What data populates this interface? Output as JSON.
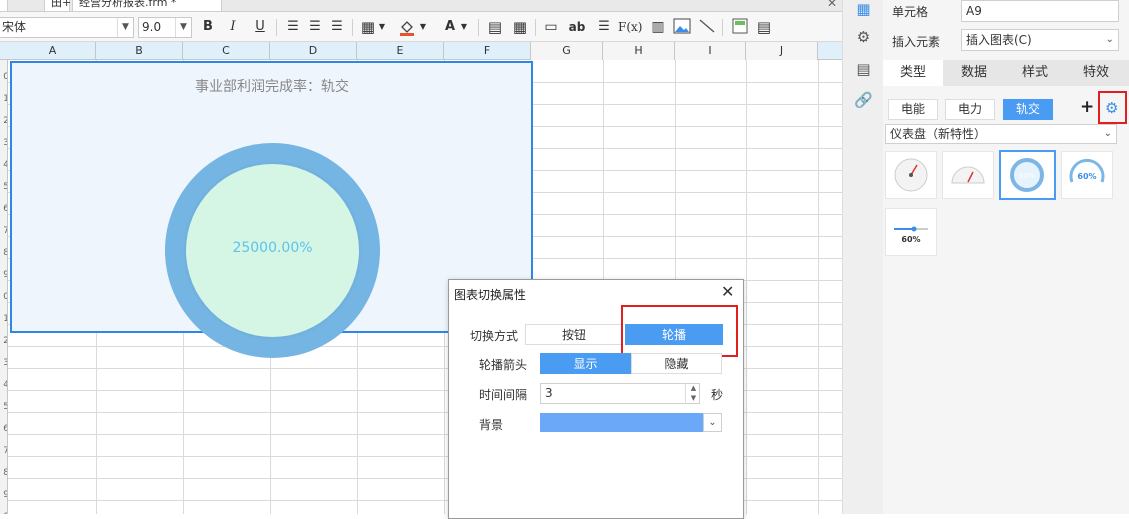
{
  "tabstrip": {
    "tab_left": "田+",
    "tab_file": "经营分析报表.frm *",
    "close_icon": "close-icon"
  },
  "toolbar": {
    "font_name": "宋体",
    "font_size": "9.0",
    "bold": "B",
    "italic": "I",
    "underline": "U",
    "text_color_label": "A",
    "abc_label": "ab",
    "formula_label": "F(x)"
  },
  "grid": {
    "columns": [
      "A",
      "B",
      "C",
      "D",
      "E",
      "F",
      "G",
      "H",
      "I",
      "J"
    ],
    "row_numbers": [
      "0",
      "1",
      "2",
      "3",
      "4",
      "5",
      "6",
      "7",
      "8",
      "9",
      "0",
      "1",
      "2",
      "3",
      "4",
      "5",
      "6",
      "7",
      "8",
      "9",
      "0"
    ]
  },
  "chart": {
    "title": "事业部利润完成率：轨交",
    "value_label": "25000.00%",
    "ring_color": "#74b5e3",
    "fill_color": "#d5f5e5"
  },
  "dialog": {
    "title": "图表切换属性",
    "switch_mode_label": "切换方式",
    "switch_mode_options": [
      "按钮",
      "轮播"
    ],
    "switch_mode_selected": "轮播",
    "arrow_label": "轮播箭头",
    "arrow_options": [
      "显示",
      "隐藏"
    ],
    "arrow_selected": "显示",
    "interval_label": "时间间隔",
    "interval_value": "3",
    "interval_unit": "秒",
    "background_label": "背景",
    "background_color": "#6ba8f7"
  },
  "panel": {
    "cell_label": "单元格",
    "cell_value": "A9",
    "insert_label": "插入元素",
    "insert_value": "插入图表(C)",
    "tabs": [
      "类型",
      "数据",
      "样式",
      "特效"
    ],
    "active_tab": "类型",
    "chart_pills": [
      "电能",
      "电力",
      "轨交"
    ],
    "active_pill": "轨交",
    "chart_type_value": "仪表盘（新特性）",
    "thumbnails": [
      {
        "name": "dial-gauge-thumb"
      },
      {
        "name": "semi-dial-gauge-thumb"
      },
      {
        "name": "ring-gauge-thumb",
        "label": "60%"
      },
      {
        "name": "arc-gauge-thumb",
        "label": "60%"
      },
      {
        "name": "slider-gauge-thumb",
        "label": "60%"
      }
    ],
    "selected_thumbnail": "ring-gauge-thumb"
  }
}
